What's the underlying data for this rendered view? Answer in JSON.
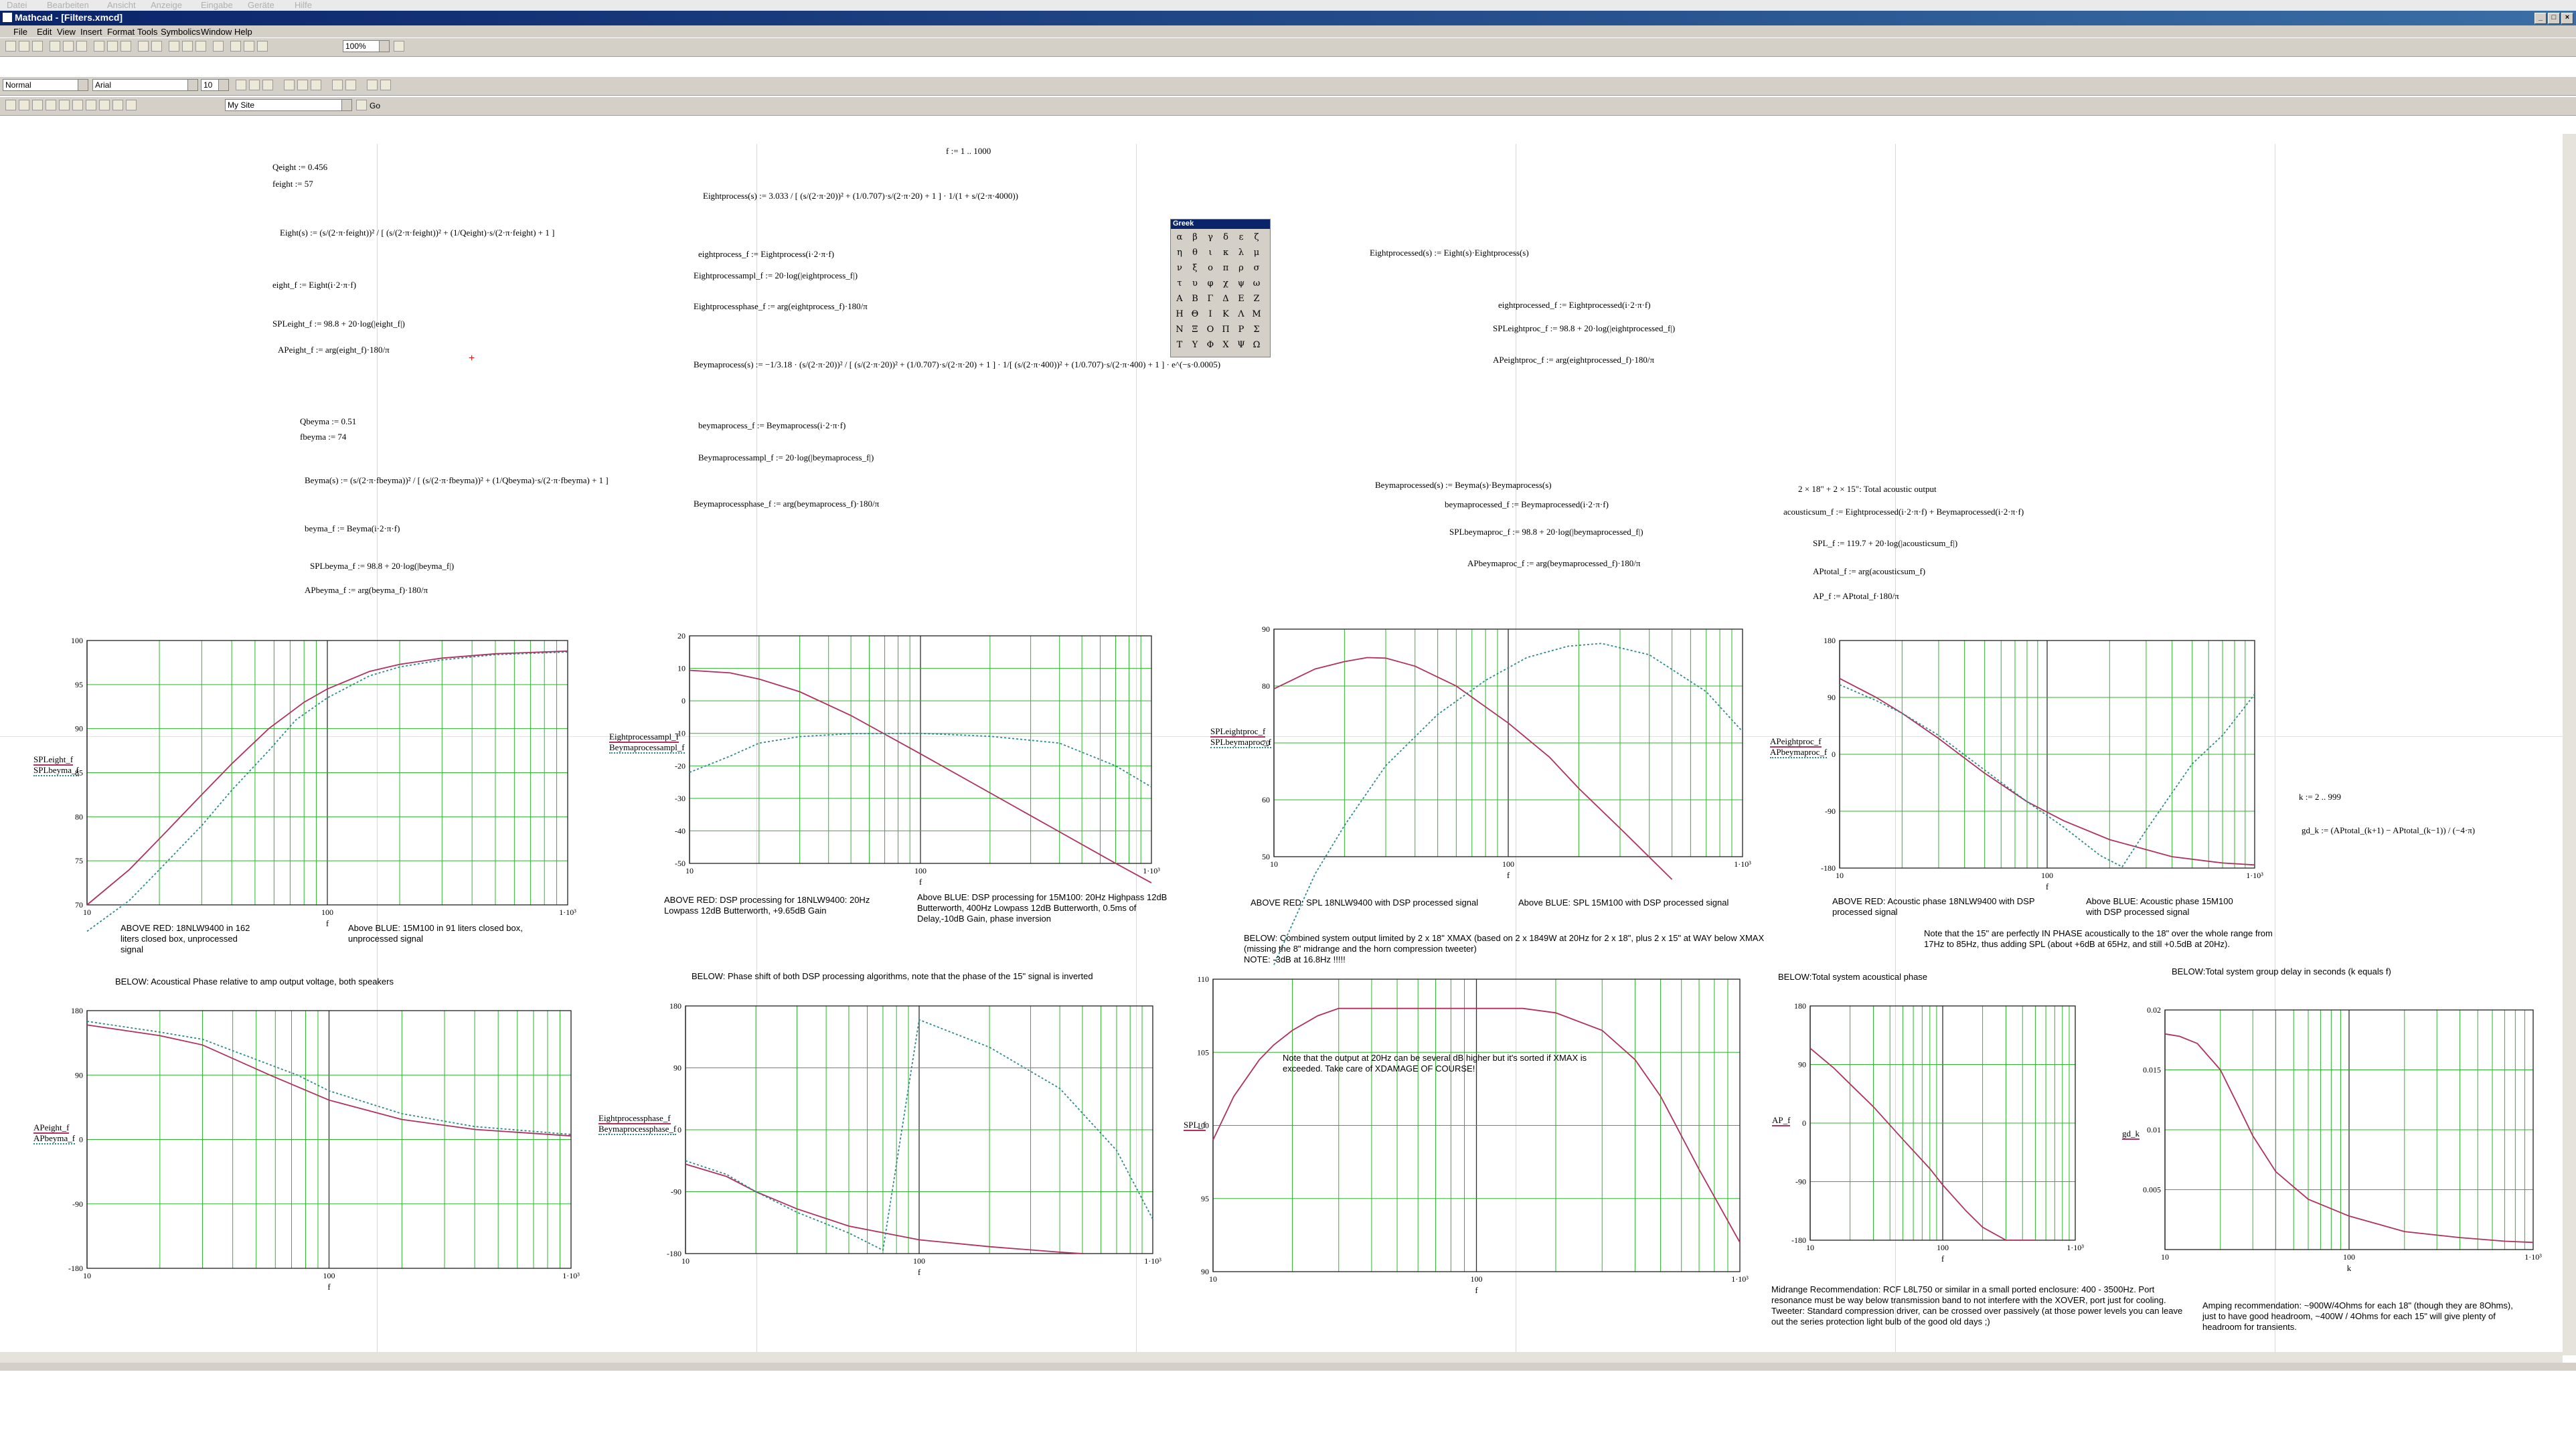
{
  "os_menu": [
    "Datei",
    "Bearbeiten",
    "Ansicht",
    "Anzeige",
    "Eingabe",
    "Geräte",
    "Hilfe"
  ],
  "window": {
    "title": "Mathcad - [Filters.xmcd]"
  },
  "menubar": [
    "File",
    "Edit",
    "View",
    "Insert",
    "Format",
    "Tools",
    "Symbolics",
    "Window",
    "Help"
  ],
  "toolbar": {
    "zoom": "100%",
    "style": "Normal",
    "font": "Arial",
    "size": "10",
    "resource": "My Site",
    "go_label": "Go"
  },
  "greek_palette": {
    "title": "Greek",
    "letters": [
      "α",
      "β",
      "γ",
      "δ",
      "ε",
      "ζ",
      "η",
      "θ",
      "ι",
      "κ",
      "λ",
      "μ",
      "ν",
      "ξ",
      "ο",
      "π",
      "ρ",
      "σ",
      "τ",
      "υ",
      "φ",
      "χ",
      "ψ",
      "ω",
      "Α",
      "Β",
      "Γ",
      "Δ",
      "Ε",
      "Ζ",
      "Η",
      "Θ",
      "Ι",
      "Κ",
      "Λ",
      "Μ",
      "Ν",
      "Ξ",
      "Ο",
      "Π",
      "Ρ",
      "Σ",
      "Τ",
      "Υ",
      "Φ",
      "Χ",
      "Ψ",
      "Ω"
    ]
  },
  "equations": {
    "qeight": "Qeight := 0.456",
    "feight": "feight := 57",
    "eight_def": "Eight(s) := (s/(2·π·feight))² / [ (s/(2·π·feight))² + (1/Qeight)·s/(2·π·feight) + 1 ]",
    "eight_f": "eight_f := Eight(i·2·π·f)",
    "spl_eight": "SPLeight_f := 98.8 + 20·log(|eight_f|)",
    "ap_eight": "APeight_f := arg(eight_f)·180/π",
    "qbeyma": "Qbeyma := 0.51",
    "fbeyma": "fbeyma := 74",
    "beyma_def": "Beyma(s) := (s/(2·π·fbeyma))² / [ (s/(2·π·fbeyma))² + (1/Qbeyma)·s/(2·π·fbeyma) + 1 ]",
    "beyma_f": "beyma_f := Beyma(i·2·π·f)",
    "spl_beyma": "SPLbeyma_f := 98.8 + 20·log(|beyma_f|)",
    "ap_beyma": "APbeyma_f := arg(beyma_f)·180/π",
    "f_range": "f := 1 .. 1000",
    "eightprocess_def": "Eightprocess(s) := 3.033 / [ (s/(2·π·20))² + (1/0.707)·s/(2·π·20) + 1 ] · 1/(1 + s/(2·π·4000))",
    "eightprocess_f": "eightprocess_f := Eightprocess(i·2·π·f)",
    "eightprocessampl": "Eightprocessampl_f := 20·log(|eightprocess_f|)",
    "eightprocessphase": "Eightprocessphase_f := arg(eightprocess_f)·180/π",
    "beymaprocess_def": "Beymaprocess(s) := −1/3.18 · (s/(2·π·20))² / [ (s/(2·π·20))² + (1/0.707)·s/(2·π·20) + 1 ] · 1/[ (s/(2·π·400))² + (1/0.707)·s/(2·π·400) + 1 ] · e^(−s·0.0005)",
    "beymaprocess_f": "beymaprocess_f := Beymaprocess(i·2·π·f)",
    "beymaprocessampl": "Beymaprocessampl_f := 20·log(|beymaprocess_f|)",
    "beymaprocessphase": "Beymaprocessphase_f := arg(beymaprocess_f)·180/π",
    "eightprocessed_def": "Eightprocessed(s) := Eight(s)·Eightprocess(s)",
    "eightprocessed_f": "eightprocessed_f := Eightprocessed(i·2·π·f)",
    "spl_eightproc": "SPLeightproc_f := 98.8 + 20·log(|eightprocessed_f|)",
    "ap_eightproc": "APeightproc_f := arg(eightprocessed_f)·180/π",
    "beymaprocessed_def": "Beymaprocessed(s) := Beyma(s)·Beymaprocess(s)",
    "beymaprocessed_f": "beymaprocessed_f := Beymaprocessed(i·2·π·f)",
    "spl_beymaproc": "SPLbeymaproc_f := 98.8 + 20·log(|beymaprocessed_f|)",
    "ap_beymaproc": "APbeymaproc_f := arg(beymaprocessed_f)·180/π",
    "total_title": "2 × 18\" + 2 × 15\": Total acoustic output",
    "acoustic_sum": "acousticsum_f := Eightprocessed(i·2·π·f) + Beymaprocessed(i·2·π·f)",
    "spl_total": "SPL_f := 119.7 + 20·log(|acousticsum_f|)",
    "ap_total": "APtotal_f := arg(acousticsum_f)",
    "ap_deg": "AP_f := APtotal_f·180/π",
    "k_range": "k := 2 .. 999",
    "gd_def": "gd_k := (APtotal_(k+1) − APtotal_(k−1)) / (−4·π)"
  },
  "notes": {
    "n1a": "ABOVE RED: 18NLW9400 in 162 liters closed box, unprocessed signal",
    "n1b": "Above BLUE: 15M100 in 91 liters closed box, unprocessed signal",
    "n1c": "BELOW: Acoustical Phase relative to amp output voltage, both speakers",
    "n2a": "ABOVE RED: DSP processing for 18NLW9400: 20Hz Lowpass 12dB Butterworth, +9.65dB Gain",
    "n2b": "Above BLUE: DSP processing for 15M100: 20Hz Highpass 12dB Butterworth, 400Hz Lowpass 12dB Butterworth, 0.5ms of Delay,-10dB Gain, phase inversion",
    "n2c": "BELOW: Phase shift of both DSP processing algorithms, note that the phase of the 15\" signal is inverted",
    "n3a": "ABOVE RED: SPL 18NLW9400 with DSP processed signal",
    "n3b": "Above BLUE: SPL 15M100 with DSP processed signal",
    "n3c": "BELOW:  Combined system output limited by 2 x 18\" XMAX (based on 2 x 1849W at 20Hz for 2 x 18\", plus 2 x 15\" at WAY below XMAX (missing the 8\" midrange and the horn compression tweeter)",
    "n3d": "NOTE: -3dB at 16.8Hz !!!!!",
    "n3e": "Note that the output at 20Hz can be several dB higher but it's sorted if XMAX is exceeded. Take care of XDAMAGE OF COURSE!",
    "n4a": "ABOVE RED: Acoustic phase 18NLW9400 with DSP processed signal",
    "n4b": "Above BLUE: Acoustic phase 15M100 with DSP processed signal",
    "n4c": "Note that the 15\" are perfectly IN PHASE acoustically to the 18\" over the whole range from 17Hz to 85Hz, thus adding SPL (about +6dB at 65Hz, and still +0.5dB at 20Hz).",
    "n4d": "BELOW:Total system acoustical phase",
    "n5a": "BELOW:Total system group delay in seconds (k equals f)",
    "n6": "Midrange Recommendation: RCF L8L750 or similar in a small ported enclosure: 400 - 3500Hz. Port resonance must be way below transmission band to not interfere with the XOVER, port just for cooling. Tweeter: Standard compression driver, can be crossed over passively (at those power levels you can leave out the series protection light bulb of the good old days ;)",
    "n7": "Amping recommendation: ~900W/4Ohms for each 18\" (though they are 8Ohms), just to have good headroom, ~400W / 4Ohms for each 15\" will give plenty of headroom for transients."
  },
  "charts": {
    "c1": {
      "ylabels": [
        "SPLeight_f",
        "SPLbeyma_f"
      ]
    },
    "c2": {
      "ylabels": [
        "Eightprocessampl_f",
        "Beymaprocessampl_f"
      ]
    },
    "c3": {
      "ylabels": [
        "SPLeightproc_f",
        "SPLbeymaproc_f"
      ]
    },
    "c4": {
      "ylabels": [
        "APeightproc_f",
        "APbeymaproc_f"
      ]
    },
    "c5": {
      "ylabels": [
        "APeight_f",
        "APbeyma_f"
      ]
    },
    "c6": {
      "ylabels": [
        "Eightprocessphase_f",
        "Beymaprocessphase_f"
      ]
    },
    "c7": {
      "ylabels": [
        "SPL_f"
      ]
    },
    "c8": {
      "ylabels": [
        "AP_f"
      ]
    },
    "c9": {
      "ylabels": [
        "gd_k"
      ]
    }
  },
  "chart_data": [
    {
      "type": "line",
      "xscale": "log",
      "xlim": [
        10,
        1000
      ],
      "ylim": [
        70,
        100
      ],
      "xticks": [
        "10",
        "100",
        "1·10³"
      ],
      "yticks": [
        "100",
        "95",
        "90",
        "85",
        "80",
        "75",
        "70"
      ],
      "xlabel": "f",
      "series": [
        {
          "name": "SPLeight_f",
          "color": "#b03060",
          "x": [
            10,
            15,
            20,
            30,
            40,
            57,
            80,
            100,
            150,
            200,
            300,
            500,
            1000
          ],
          "values": [
            70,
            74,
            77.5,
            82.5,
            86,
            90,
            93,
            94.5,
            96.5,
            97.3,
            98,
            98.5,
            98.8
          ]
        },
        {
          "name": "SPLbeyma_f",
          "color": "#2c8a8a",
          "x": [
            10,
            15,
            20,
            30,
            40,
            57,
            74,
            100,
            150,
            200,
            300,
            500,
            1000
          ],
          "values": [
            67,
            70.5,
            74,
            79,
            83,
            87.5,
            91,
            93.5,
            96,
            97,
            97.8,
            98.4,
            98.7
          ]
        }
      ]
    },
    {
      "type": "line",
      "xscale": "log",
      "xlim": [
        10,
        1000
      ],
      "ylim": [
        -50,
        20
      ],
      "xticks": [
        "10",
        "100",
        "1·10³"
      ],
      "yticks": [
        "20",
        "10",
        "0",
        "-10",
        "-20",
        "-30",
        "-40",
        "-50"
      ],
      "xlabel": "f",
      "series": [
        {
          "name": "Eightprocessampl_f",
          "color": "#b03060",
          "x": [
            10,
            15,
            20,
            30,
            50,
            100,
            200,
            400,
            700,
            1000
          ],
          "values": [
            9.4,
            8.6,
            6.7,
            2.8,
            -4.5,
            -16.3,
            -28.3,
            -40.3,
            -50,
            -56
          ]
        },
        {
          "name": "Beymaprocessampl_f",
          "color": "#2c8a8a",
          "x": [
            10,
            15,
            20,
            30,
            50,
            100,
            200,
            400,
            700,
            1000
          ],
          "values": [
            -22,
            -17,
            -13,
            -11,
            -10.1,
            -10,
            -10.9,
            -13,
            -20,
            -26.5
          ]
        }
      ]
    },
    {
      "type": "line",
      "xscale": "log",
      "xlim": [
        10,
        1000
      ],
      "ylim": [
        50,
        90
      ],
      "xticks": [
        "10",
        "100",
        "1·10³"
      ],
      "yticks": [
        "90",
        "80",
        "70",
        "60",
        "50"
      ],
      "xlabel": "f",
      "series": [
        {
          "name": "SPLeightproc_f",
          "color": "#b03060",
          "x": [
            10,
            15,
            20,
            25,
            30,
            40,
            60,
            100,
            150,
            200,
            300,
            500
          ],
          "values": [
            79.5,
            83,
            84.3,
            85,
            84.9,
            83.5,
            80,
            73.5,
            67.5,
            62,
            55,
            46
          ]
        },
        {
          "name": "SPLbeymaproc_f",
          "color": "#2c8a8a",
          "x": [
            10,
            15,
            20,
            30,
            50,
            80,
            120,
            180,
            250,
            400,
            700,
            1000
          ],
          "values": [
            31,
            47,
            55.5,
            66,
            75,
            81,
            85,
            87,
            87.5,
            85.5,
            79,
            72
          ]
        }
      ]
    },
    {
      "type": "line",
      "xscale": "log",
      "xlim": [
        10,
        1000
      ],
      "ylim": [
        -180,
        180
      ],
      "xticks": [
        "10",
        "100",
        "1·10³"
      ],
      "yticks": [
        "180",
        "90",
        "0",
        "-90",
        "-180"
      ],
      "xlabel": "f",
      "series": [
        {
          "name": "APeightproc_f",
          "color": "#b03060",
          "x": [
            10,
            15,
            20,
            30,
            50,
            80,
            120,
            200,
            400,
            700,
            1000
          ],
          "values": [
            120,
            90,
            65,
            25,
            -30,
            -75,
            -105,
            -135,
            -162,
            -172,
            -175
          ]
        },
        {
          "name": "APbeymaproc_f",
          "color": "#2c8a8a",
          "x": [
            10,
            15,
            20,
            30,
            50,
            80,
            120,
            180,
            230,
            300,
            500,
            700,
            1000
          ],
          "values": [
            110,
            85,
            65,
            30,
            -25,
            -75,
            -115,
            -160,
            -178,
            -120,
            -15,
            30,
            95
          ]
        }
      ]
    },
    {
      "type": "line",
      "xscale": "log",
      "xlim": [
        10,
        1000
      ],
      "ylim": [
        -180,
        180
      ],
      "xticks": [
        "10",
        "100",
        "1·10³"
      ],
      "yticks": [
        "180",
        "90",
        "0",
        "-90",
        "-180"
      ],
      "xlabel": "f",
      "series": [
        {
          "name": "APeight_f",
          "color": "#b03060",
          "x": [
            10,
            20,
            30,
            57,
            100,
            200,
            400,
            1000
          ],
          "values": [
            160,
            145,
            132,
            90,
            55,
            28,
            14,
            5
          ]
        },
        {
          "name": "APbeyma_f",
          "color": "#2c8a8a",
          "x": [
            10,
            20,
            30,
            74,
            100,
            200,
            400,
            1000
          ],
          "values": [
            165,
            150,
            140,
            90,
            68,
            36,
            18,
            7
          ]
        }
      ]
    },
    {
      "type": "line",
      "xscale": "log",
      "xlim": [
        10,
        1000
      ],
      "ylim": [
        -180,
        180
      ],
      "xticks": [
        "10",
        "100",
        "1·10³"
      ],
      "yticks": [
        "180",
        "90",
        "0",
        "-90",
        "-180"
      ],
      "xlabel": "f",
      "series": [
        {
          "name": "Eightprocessphase_f",
          "color": "#b03060",
          "x": [
            10,
            15,
            20,
            30,
            50,
            100,
            200,
            400,
            500
          ],
          "values": [
            -50,
            -68,
            -90,
            -115,
            -140,
            -160,
            -170,
            -178,
            -180
          ]
        },
        {
          "name": "Beymaprocessphase_f",
          "color": "#2c8a8a",
          "x": [
            10,
            15,
            20,
            30,
            50,
            70,
            100,
            200,
            400,
            700,
            1000
          ],
          "values": [
            -45,
            -65,
            -90,
            -120,
            -150,
            -175,
            160,
            120,
            60,
            -30,
            -130
          ]
        }
      ]
    },
    {
      "type": "line",
      "xscale": "log",
      "xlim": [
        10,
        1000
      ],
      "ylim": [
        90,
        110
      ],
      "xticks": [
        "10",
        "100",
        "1·10³"
      ],
      "yticks": [
        "110",
        "105",
        "100",
        "95",
        "90"
      ],
      "xlabel": "f",
      "series": [
        {
          "name": "SPL_f",
          "color": "#b03060",
          "x": [
            10,
            12,
            15,
            17,
            20,
            25,
            30,
            40,
            60,
            85,
            100,
            150,
            200,
            300,
            400,
            500,
            700,
            1000
          ],
          "values": [
            99,
            102,
            104.5,
            105.5,
            106.5,
            107.5,
            108,
            108,
            108,
            108,
            108,
            108,
            107.7,
            106.5,
            104.5,
            102,
            97,
            92
          ]
        }
      ]
    },
    {
      "type": "line",
      "xscale": "log",
      "xlim": [
        10,
        1000
      ],
      "ylim": [
        -180,
        180
      ],
      "xticks": [
        "10",
        "100",
        "1·10³"
      ],
      "yticks": [
        "180",
        "90",
        "0",
        "-90",
        "-180"
      ],
      "xlabel": "f",
      "series": [
        {
          "name": "AP_f",
          "color": "#b03060",
          "x": [
            10,
            15,
            20,
            30,
            50,
            80,
            100,
            150,
            200,
            300,
            500
          ],
          "values": [
            115,
            85,
            60,
            25,
            -25,
            -70,
            -95,
            -135,
            -160,
            -180,
            -180
          ]
        }
      ]
    },
    {
      "type": "line",
      "xscale": "log",
      "xlim": [
        10,
        1000
      ],
      "ylim": [
        0,
        0.02
      ],
      "xticks": [
        "10",
        "100",
        "1·10³"
      ],
      "yticks": [
        "0.02",
        "0.015",
        "0.01",
        "0.005"
      ],
      "xlabel": "k",
      "series": [
        {
          "name": "gd_k",
          "color": "#b03060",
          "x": [
            10,
            12,
            15,
            20,
            25,
            30,
            40,
            60,
            100,
            200,
            400,
            700,
            1000
          ],
          "values": [
            0.018,
            0.0178,
            0.0172,
            0.015,
            0.012,
            0.0095,
            0.0065,
            0.0042,
            0.0028,
            0.0015,
            0.001,
            0.0007,
            0.0006
          ]
        }
      ]
    }
  ]
}
